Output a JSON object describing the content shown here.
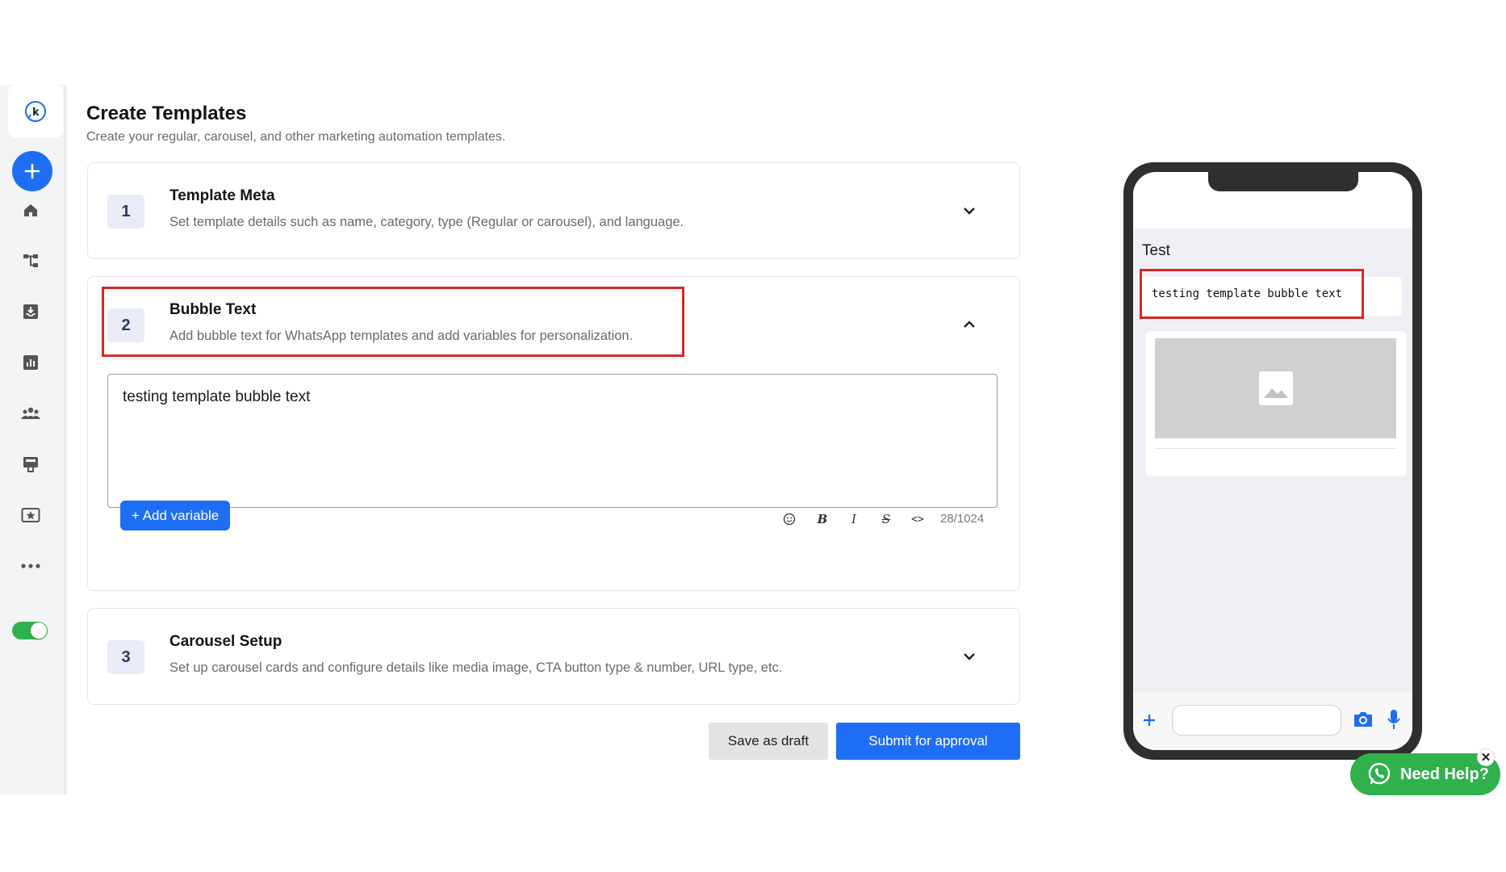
{
  "header": {
    "title": "Create Templates",
    "subtitle": "Create your regular, carousel, and other marketing automation templates."
  },
  "sidebar": {
    "logo_letter": "k",
    "items": [
      {
        "icon": "home-icon"
      },
      {
        "icon": "flow-icon"
      },
      {
        "icon": "inbox-icon"
      },
      {
        "icon": "analytics-icon"
      },
      {
        "icon": "contacts-icon"
      },
      {
        "icon": "templates-icon"
      },
      {
        "icon": "campaigns-icon"
      },
      {
        "icon": "more-icon"
      }
    ],
    "toggle_on": true
  },
  "steps": [
    {
      "number": "1",
      "title": "Template Meta",
      "description": "Set template details such as name, category, type (Regular or carousel), and language."
    },
    {
      "number": "2",
      "title": "Bubble Text",
      "description": "Add bubble text for WhatsApp templates and add variables for personalization."
    },
    {
      "number": "3",
      "title": "Carousel Setup",
      "description": "Set up carousel cards and configure details like media image, CTA button type & number, URL type, etc."
    }
  ],
  "editor": {
    "value": "testing template bubble text",
    "add_variable_label": "+ Add variable",
    "char_count": "28/1024",
    "format_labels": {
      "bold": "B",
      "italic": "I",
      "strike": "S",
      "code": "<>"
    }
  },
  "actions": {
    "save_draft_label": "Save as draft",
    "submit_label": "Submit for approval"
  },
  "preview": {
    "chat_name": "Test",
    "bubble_text": "testing template bubble text"
  },
  "help": {
    "label": "Need Help?",
    "close": "✕"
  },
  "colors": {
    "primary": "#1e6ef5",
    "highlight": "#d62828",
    "whatsapp_green": "#2fb24c"
  }
}
